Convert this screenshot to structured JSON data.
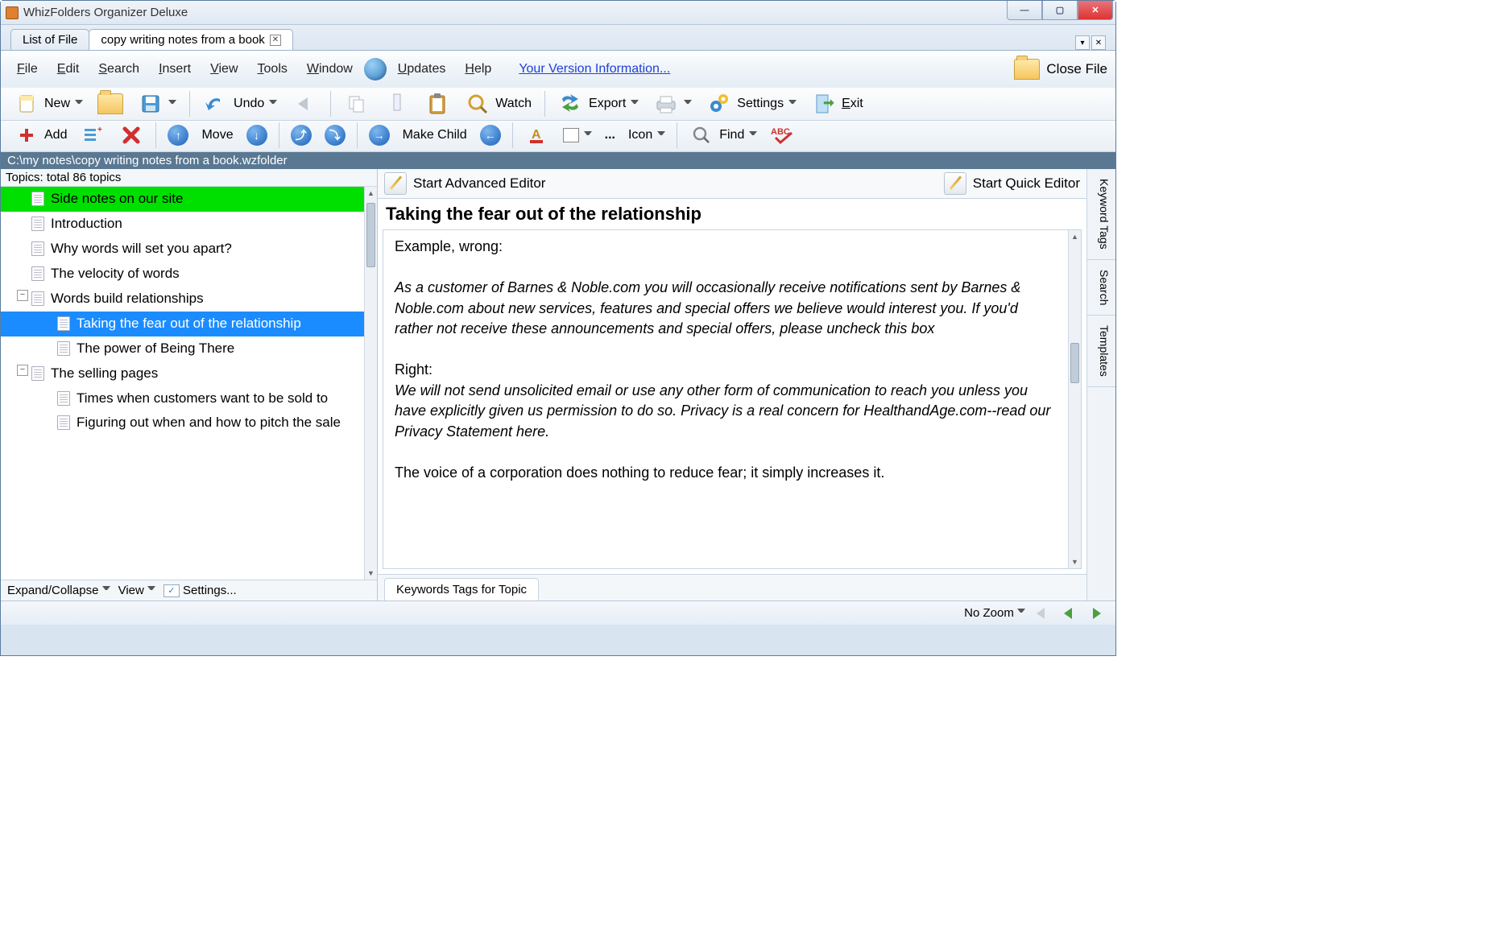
{
  "window": {
    "title": "WhizFolders Organizer Deluxe"
  },
  "tabs": {
    "items": [
      {
        "label": "List of File",
        "active": false,
        "closable": false
      },
      {
        "label": "copy writing notes from a book",
        "active": true,
        "closable": true
      }
    ]
  },
  "menubar": {
    "items": [
      "File",
      "Edit",
      "Search",
      "Insert",
      "View",
      "Tools",
      "Window"
    ],
    "updates": "Updates",
    "help": "Help",
    "version_link": "Your Version Information...",
    "close_file": "Close File"
  },
  "toolbar1": {
    "new": "New",
    "undo": "Undo",
    "watch": "Watch",
    "export": "Export",
    "settings": "Settings",
    "exit": "Exit"
  },
  "toolbar2": {
    "add": "Add",
    "move": "Move",
    "make_child": "Make Child",
    "icon": "Icon",
    "find": "Find"
  },
  "pathbar": "C:\\my notes\\copy writing notes from a book.wzfolder",
  "topics": {
    "header": "Topics: total 86 topics",
    "items": [
      {
        "label": "Side notes on our site",
        "indent": 0,
        "highlight": "green"
      },
      {
        "label": "Introduction",
        "indent": 0
      },
      {
        "label": "Why words will set you apart?",
        "indent": 0
      },
      {
        "label": "The velocity of words",
        "indent": 0
      },
      {
        "label": "Words build relationships",
        "indent": 0,
        "expander": "-"
      },
      {
        "label": "Taking the fear out of the relationship",
        "indent": 1,
        "highlight": "blue"
      },
      {
        "label": "The power of Being There",
        "indent": 1
      },
      {
        "label": "The selling pages",
        "indent": 0,
        "expander": "-"
      },
      {
        "label": "Times when customers want to be sold to",
        "indent": 1
      },
      {
        "label": "Figuring out when and how to pitch the sale",
        "indent": 1
      }
    ],
    "footer": {
      "expand": "Expand/Collapse",
      "view": "View",
      "settings": "Settings..."
    }
  },
  "editor": {
    "start_advanced": "Start Advanced Editor",
    "start_quick": "Start Quick Editor",
    "title": "Taking the fear out of the relationship",
    "p1": "Example, wrong:",
    "p2": "As a customer of Barnes & Noble.com you will occasionally receive notifications sent by Barnes & Noble.com about new services, features and special offers we believe would interest you. If you'd rather not receive these announcements and special offers, please uncheck this box",
    "p3": "Right:",
    "p4": "We will not send unsolicited email or use any other form of communication to reach you unless you have explicitly given us permission to do so. Privacy is a real concern for HealthandAge.com--read our Privacy Statement here.",
    "p5": "The voice of a corporation does nothing to reduce fear; it simply increases it.",
    "keywords_tab": "Keywords Tags for Topic"
  },
  "sidetabs": [
    "Keyword Tags",
    "Search",
    "Templates"
  ],
  "statusbar": {
    "zoom": "No Zoom"
  }
}
